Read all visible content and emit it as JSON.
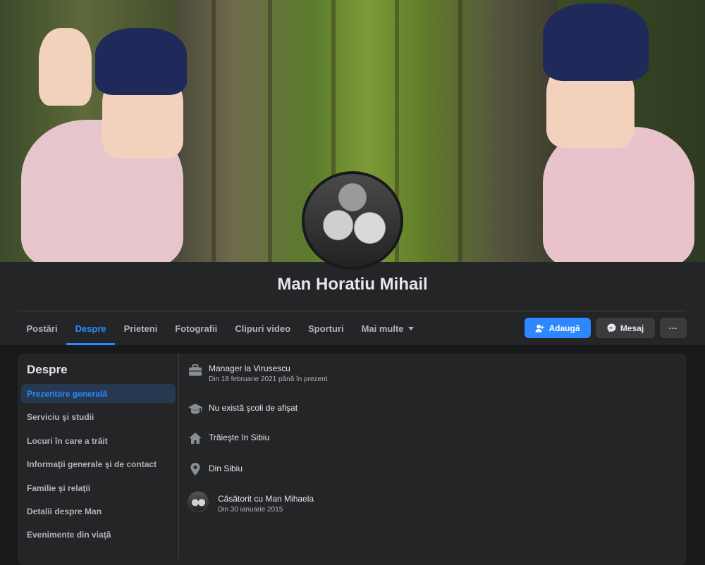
{
  "profile": {
    "name": "Man Horatiu Mihail"
  },
  "tabs": [
    {
      "label": "Postări"
    },
    {
      "label": "Despre"
    },
    {
      "label": "Prieteni"
    },
    {
      "label": "Fotografii"
    },
    {
      "label": "Clipuri video"
    },
    {
      "label": "Sporturi"
    },
    {
      "label": "Mai multe"
    }
  ],
  "actions": {
    "add_label": "Adaugă",
    "message_label": "Mesaj",
    "more_label": "···"
  },
  "about": {
    "title": "Despre",
    "sections": [
      {
        "label": "Prezentare generală"
      },
      {
        "label": "Serviciu şi studii"
      },
      {
        "label": "Locuri în care a trăit"
      },
      {
        "label": "Informaţii generale şi de contact"
      },
      {
        "label": "Familie şi relaţii"
      },
      {
        "label": "Detalii despre Man"
      },
      {
        "label": "Evenimente din viaţă"
      }
    ],
    "overview": {
      "work": {
        "title": "Manager la Virusescu",
        "subtitle": "Din 18 februarie 2021 până în prezent"
      },
      "education": {
        "title": "Nu există şcoli de afişat"
      },
      "lives": {
        "title": "Trăieşte în Sibiu"
      },
      "from": {
        "title": "Din Sibiu"
      },
      "relationship": {
        "title": "Căsătorit cu Man Mihaela",
        "subtitle": "Din 30 ianuarie 2015"
      }
    }
  },
  "colors": {
    "accent": "#2d88ff",
    "background": "#18191a",
    "card": "#242526",
    "text": "#e4e6eb",
    "muted": "#b0b3b8"
  }
}
